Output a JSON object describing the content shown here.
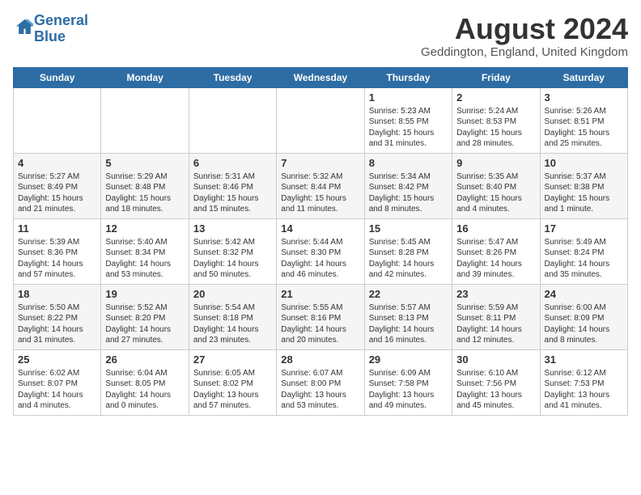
{
  "header": {
    "logo_line1": "General",
    "logo_line2": "Blue",
    "month_title": "August 2024",
    "location": "Geddington, England, United Kingdom"
  },
  "weekdays": [
    "Sunday",
    "Monday",
    "Tuesday",
    "Wednesday",
    "Thursday",
    "Friday",
    "Saturday"
  ],
  "weeks": [
    [
      {
        "day": "",
        "info": ""
      },
      {
        "day": "",
        "info": ""
      },
      {
        "day": "",
        "info": ""
      },
      {
        "day": "",
        "info": ""
      },
      {
        "day": "1",
        "info": "Sunrise: 5:23 AM\nSunset: 8:55 PM\nDaylight: 15 hours\nand 31 minutes."
      },
      {
        "day": "2",
        "info": "Sunrise: 5:24 AM\nSunset: 8:53 PM\nDaylight: 15 hours\nand 28 minutes."
      },
      {
        "day": "3",
        "info": "Sunrise: 5:26 AM\nSunset: 8:51 PM\nDaylight: 15 hours\nand 25 minutes."
      }
    ],
    [
      {
        "day": "4",
        "info": "Sunrise: 5:27 AM\nSunset: 8:49 PM\nDaylight: 15 hours\nand 21 minutes."
      },
      {
        "day": "5",
        "info": "Sunrise: 5:29 AM\nSunset: 8:48 PM\nDaylight: 15 hours\nand 18 minutes."
      },
      {
        "day": "6",
        "info": "Sunrise: 5:31 AM\nSunset: 8:46 PM\nDaylight: 15 hours\nand 15 minutes."
      },
      {
        "day": "7",
        "info": "Sunrise: 5:32 AM\nSunset: 8:44 PM\nDaylight: 15 hours\nand 11 minutes."
      },
      {
        "day": "8",
        "info": "Sunrise: 5:34 AM\nSunset: 8:42 PM\nDaylight: 15 hours\nand 8 minutes."
      },
      {
        "day": "9",
        "info": "Sunrise: 5:35 AM\nSunset: 8:40 PM\nDaylight: 15 hours\nand 4 minutes."
      },
      {
        "day": "10",
        "info": "Sunrise: 5:37 AM\nSunset: 8:38 PM\nDaylight: 15 hours\nand 1 minute."
      }
    ],
    [
      {
        "day": "11",
        "info": "Sunrise: 5:39 AM\nSunset: 8:36 PM\nDaylight: 14 hours\nand 57 minutes."
      },
      {
        "day": "12",
        "info": "Sunrise: 5:40 AM\nSunset: 8:34 PM\nDaylight: 14 hours\nand 53 minutes."
      },
      {
        "day": "13",
        "info": "Sunrise: 5:42 AM\nSunset: 8:32 PM\nDaylight: 14 hours\nand 50 minutes."
      },
      {
        "day": "14",
        "info": "Sunrise: 5:44 AM\nSunset: 8:30 PM\nDaylight: 14 hours\nand 46 minutes."
      },
      {
        "day": "15",
        "info": "Sunrise: 5:45 AM\nSunset: 8:28 PM\nDaylight: 14 hours\nand 42 minutes."
      },
      {
        "day": "16",
        "info": "Sunrise: 5:47 AM\nSunset: 8:26 PM\nDaylight: 14 hours\nand 39 minutes."
      },
      {
        "day": "17",
        "info": "Sunrise: 5:49 AM\nSunset: 8:24 PM\nDaylight: 14 hours\nand 35 minutes."
      }
    ],
    [
      {
        "day": "18",
        "info": "Sunrise: 5:50 AM\nSunset: 8:22 PM\nDaylight: 14 hours\nand 31 minutes."
      },
      {
        "day": "19",
        "info": "Sunrise: 5:52 AM\nSunset: 8:20 PM\nDaylight: 14 hours\nand 27 minutes."
      },
      {
        "day": "20",
        "info": "Sunrise: 5:54 AM\nSunset: 8:18 PM\nDaylight: 14 hours\nand 23 minutes."
      },
      {
        "day": "21",
        "info": "Sunrise: 5:55 AM\nSunset: 8:16 PM\nDaylight: 14 hours\nand 20 minutes."
      },
      {
        "day": "22",
        "info": "Sunrise: 5:57 AM\nSunset: 8:13 PM\nDaylight: 14 hours\nand 16 minutes."
      },
      {
        "day": "23",
        "info": "Sunrise: 5:59 AM\nSunset: 8:11 PM\nDaylight: 14 hours\nand 12 minutes."
      },
      {
        "day": "24",
        "info": "Sunrise: 6:00 AM\nSunset: 8:09 PM\nDaylight: 14 hours\nand 8 minutes."
      }
    ],
    [
      {
        "day": "25",
        "info": "Sunrise: 6:02 AM\nSunset: 8:07 PM\nDaylight: 14 hours\nand 4 minutes."
      },
      {
        "day": "26",
        "info": "Sunrise: 6:04 AM\nSunset: 8:05 PM\nDaylight: 14 hours\nand 0 minutes."
      },
      {
        "day": "27",
        "info": "Sunrise: 6:05 AM\nSunset: 8:02 PM\nDaylight: 13 hours\nand 57 minutes."
      },
      {
        "day": "28",
        "info": "Sunrise: 6:07 AM\nSunset: 8:00 PM\nDaylight: 13 hours\nand 53 minutes."
      },
      {
        "day": "29",
        "info": "Sunrise: 6:09 AM\nSunset: 7:58 PM\nDaylight: 13 hours\nand 49 minutes."
      },
      {
        "day": "30",
        "info": "Sunrise: 6:10 AM\nSunset: 7:56 PM\nDaylight: 13 hours\nand 45 minutes."
      },
      {
        "day": "31",
        "info": "Sunrise: 6:12 AM\nSunset: 7:53 PM\nDaylight: 13 hours\nand 41 minutes."
      }
    ]
  ]
}
